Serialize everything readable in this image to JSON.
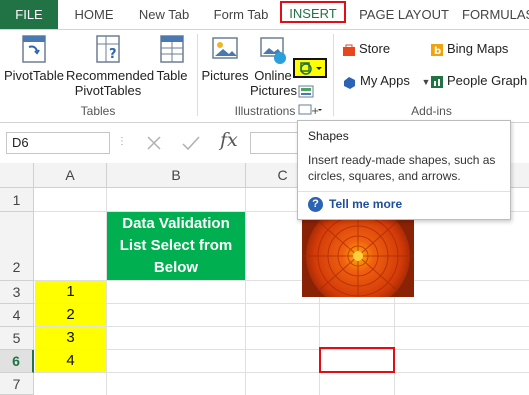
{
  "tabs": [
    "FILE",
    "HOME",
    "New Tab",
    "Form Tab",
    "INSERT",
    "PAGE LAYOUT",
    "FORMULAS"
  ],
  "ribbon": {
    "tables": {
      "pivot_table": "PivotTable",
      "recommended_line1": "Recommended",
      "recommended_line2": "PivotTables",
      "table": "Table",
      "group_label": "Tables"
    },
    "illustrations": {
      "pictures": "Pictures",
      "online_line1": "Online",
      "online_line2": "Pictures",
      "group_label": "Illustrations"
    },
    "addins": {
      "store": "Store",
      "my_apps": "My Apps",
      "bing_maps": "Bing Maps",
      "people_graph": "People Graph",
      "group_label": "Add-ins"
    }
  },
  "formula_bar": {
    "name_box": "D6",
    "fx": "fx"
  },
  "columns": [
    "A",
    "B",
    "C"
  ],
  "rows": [
    "1",
    "2",
    "3",
    "4",
    "5",
    "6",
    "7"
  ],
  "cells": {
    "b2_line1": "Data Validation",
    "b2_line2": "List Select from",
    "b2_line3": "Below",
    "a3": "1",
    "a4": "2",
    "a5": "3",
    "a6": "4"
  },
  "tooltip": {
    "title": "Shapes",
    "desc": "Insert ready-made shapes, such as circles, squares, and arrows.",
    "help": "Tell me more"
  },
  "colors": {
    "excel_green": "#217346",
    "highlight_red": "#e30d13",
    "yellow": "#ffff00",
    "green_cell": "#00b050"
  }
}
